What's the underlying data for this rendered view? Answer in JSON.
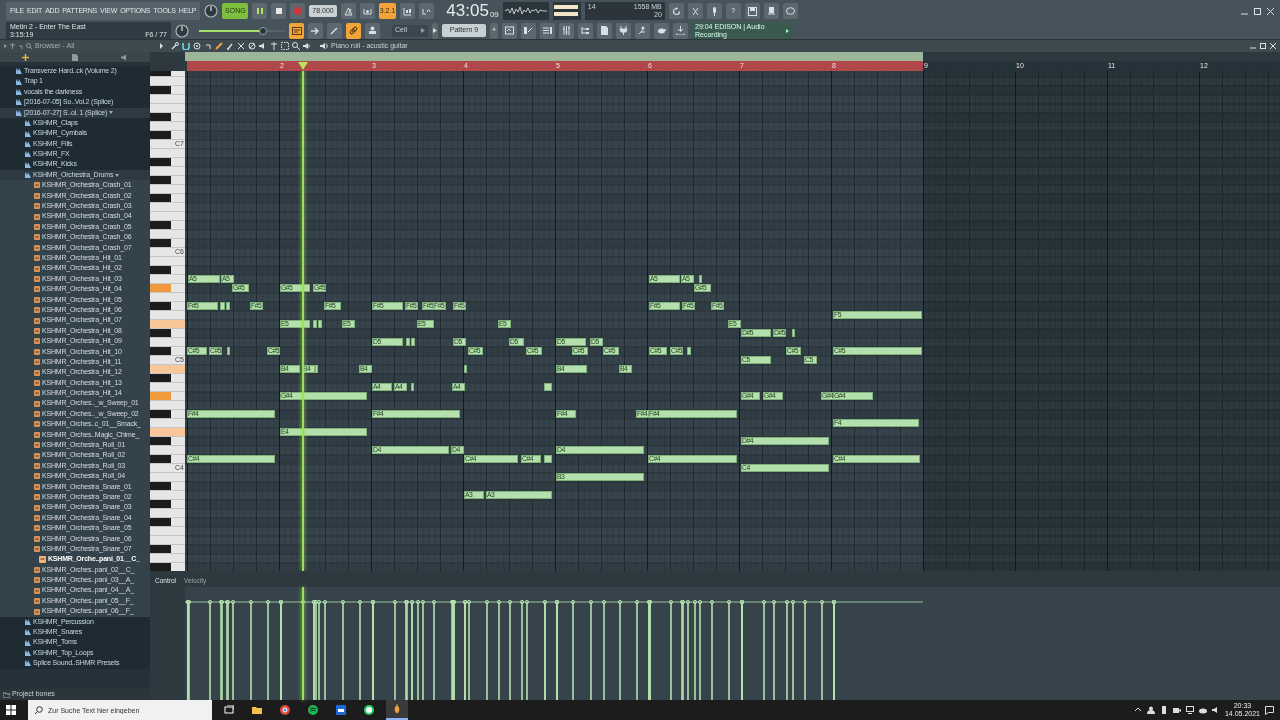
{
  "menu": [
    "FILE",
    "EDIT",
    "ADD",
    "PATTERNS",
    "VIEW",
    "OPTIONS",
    "TOOLS",
    "HELP"
  ],
  "transport": {
    "mode_label": "SONG",
    "song_mode": true,
    "playing": true,
    "recording": false,
    "tempo": "78.000"
  },
  "toggles": [
    {
      "on": false
    },
    {
      "on": false
    },
    {
      "label": "3.2.1",
      "on": true
    },
    {
      "on": false
    },
    {
      "on": false
    }
  ],
  "clock": {
    "main": "43:05",
    "sub": "09"
  },
  "monitor": {
    "cpu": "14",
    "memory": "1558 MB",
    "polyphony": "20"
  },
  "help_label": "?",
  "hint": {
    "title": "Metin 2 - Enter The East",
    "time": "3:15:19",
    "position": "F6 / 77"
  },
  "master_volume": {
    "level": 0.74
  },
  "tools": [
    {
      "on": true
    },
    {
      "on": false
    },
    {
      "on": false
    },
    {
      "on": true
    },
    {
      "on": false
    }
  ],
  "snap": "Cell",
  "pattern": {
    "name": "Pattern 9",
    "add": "+"
  },
  "news": {
    "time": "29:04",
    "title": "EDISON | Audio",
    "subtitle": "Recording"
  },
  "browser": {
    "title": "Browser - All",
    "items": [
      {
        "kind": "folder",
        "label": "Transverze Hard..ck (Volume 2)",
        "selected": false,
        "expanded": false
      },
      {
        "kind": "folder",
        "label": "Trap  1",
        "selected": false,
        "expanded": false
      },
      {
        "kind": "folder",
        "label": "vocals the darkness",
        "selected": false,
        "expanded": false
      },
      {
        "kind": "folder",
        "label": "[2016-07-05] So..Vol.2 (Splice)",
        "selected": false,
        "expanded": false
      },
      {
        "kind": "folder",
        "label": "[2016-07-27] S..ol. 1 (Splice)",
        "selected": false,
        "expanded": true,
        "children": [
          {
            "kind": "folder",
            "label": "KSHMR_Claps",
            "selected": false,
            "expanded": false
          },
          {
            "kind": "folder",
            "label": "KSHMR_Cymbals",
            "selected": false,
            "expanded": false
          },
          {
            "kind": "folder",
            "label": "KSHMR_Fills",
            "selected": false,
            "expanded": false
          },
          {
            "kind": "folder",
            "label": "KSHMR_FX",
            "selected": false,
            "expanded": false
          },
          {
            "kind": "folder",
            "label": "KSHMR_Kicks",
            "selected": false,
            "expanded": false
          },
          {
            "kind": "folder",
            "label": "KSHMR_Orchestra_Drums",
            "selected": false,
            "expanded": true,
            "children": [
              {
                "kind": "file",
                "label": "KSHMR_Orchestra_Crash_01",
                "selected": false
              },
              {
                "kind": "file",
                "label": "KSHMR_Orchestra_Crash_02",
                "selected": false
              },
              {
                "kind": "file",
                "label": "KSHMR_Orchestra_Crash_03",
                "selected": false
              },
              {
                "kind": "file",
                "label": "KSHMR_Orchestra_Crash_04",
                "selected": false
              },
              {
                "kind": "file",
                "label": "KSHMR_Orchestra_Crash_05",
                "selected": false
              },
              {
                "kind": "file",
                "label": "KSHMR_Orchestra_Crash_06",
                "selected": false
              },
              {
                "kind": "file",
                "label": "KSHMR_Orchestra_Crash_07",
                "selected": false
              },
              {
                "kind": "file",
                "label": "KSHMR_Orchestra_Hit_01",
                "selected": false
              },
              {
                "kind": "file",
                "label": "KSHMR_Orchestra_Hit_02",
                "selected": false
              },
              {
                "kind": "file",
                "label": "KSHMR_Orchestra_Hit_03",
                "selected": false
              },
              {
                "kind": "file",
                "label": "KSHMR_Orchestra_Hit_04",
                "selected": false
              },
              {
                "kind": "file",
                "label": "KSHMR_Orchestra_Hit_05",
                "selected": false
              },
              {
                "kind": "file",
                "label": "KSHMR_Orchestra_Hit_06",
                "selected": false
              },
              {
                "kind": "file",
                "label": "KSHMR_Orchestra_Hit_07",
                "selected": false
              },
              {
                "kind": "file",
                "label": "KSHMR_Orchestra_Hit_08",
                "selected": false
              },
              {
                "kind": "file",
                "label": "KSHMR_Orchestra_Hit_09",
                "selected": false
              },
              {
                "kind": "file",
                "label": "KSHMR_Orchestra_Hit_10",
                "selected": false
              },
              {
                "kind": "file",
                "label": "KSHMR_Orchestra_Hit_11",
                "selected": false
              },
              {
                "kind": "file",
                "label": "KSHMR_Orchestra_Hit_12",
                "selected": false
              },
              {
                "kind": "file",
                "label": "KSHMR_Orchestra_Hit_13",
                "selected": false
              },
              {
                "kind": "file",
                "label": "KSHMR_Orchestra_Hit_14",
                "selected": false
              },
              {
                "kind": "file",
                "label": "KSHMR_Orches.._w_Sweep_01",
                "selected": false
              },
              {
                "kind": "file",
                "label": "KSHMR_Orches.._w_Sweep_02",
                "selected": false
              },
              {
                "kind": "file",
                "label": "KSHMR_Orches..c_01__Smack_",
                "selected": false
              },
              {
                "kind": "file",
                "label": "KSHMR_Orches..Magic_Chime_",
                "selected": false
              },
              {
                "kind": "file",
                "label": "KSHMR_Orchestra_Roll_01",
                "selected": false
              },
              {
                "kind": "file",
                "label": "KSHMR_Orchestra_Roll_02",
                "selected": false
              },
              {
                "kind": "file",
                "label": "KSHMR_Orchestra_Roll_03",
                "selected": false
              },
              {
                "kind": "file",
                "label": "KSHMR_Orchestra_Roll_04",
                "selected": false
              },
              {
                "kind": "file",
                "label": "KSHMR_Orchestra_Snare_01",
                "selected": false
              },
              {
                "kind": "file",
                "label": "KSHMR_Orchestra_Snare_02",
                "selected": false
              },
              {
                "kind": "file",
                "label": "KSHMR_Orchestra_Snare_03",
                "selected": false
              },
              {
                "kind": "file",
                "label": "KSHMR_Orchestra_Snare_04",
                "selected": false
              },
              {
                "kind": "file",
                "label": "KSHMR_Orchestra_Snare_05",
                "selected": false
              },
              {
                "kind": "file",
                "label": "KSHMR_Orchestra_Snare_06",
                "selected": false
              },
              {
                "kind": "file",
                "label": "KSHMR_Orchestra_Snare_07",
                "selected": false
              },
              {
                "kind": "file",
                "label": "KSHMR_Orche..pani_01__C_",
                "selected": true
              },
              {
                "kind": "file",
                "label": "KSHMR_Orches..pani_02__C_",
                "selected": false
              },
              {
                "kind": "file",
                "label": "KSHMR_Orches..pani_03__A_",
                "selected": false
              },
              {
                "kind": "file",
                "label": "KSHMR_Orches..pani_04__A_",
                "selected": false
              },
              {
                "kind": "file",
                "label": "KSHMR_Orches..pani_05__F_",
                "selected": false
              },
              {
                "kind": "file",
                "label": "KSHMR_Orches..pani_06__F_",
                "selected": false
              }
            ]
          },
          {
            "kind": "folder",
            "label": "KSHMR_Percussion",
            "selected": false,
            "expanded": false
          },
          {
            "kind": "folder",
            "label": "KSHMR_Snares",
            "selected": false,
            "expanded": false
          },
          {
            "kind": "folder",
            "label": "KSHMR_Toms",
            "selected": false,
            "expanded": false
          },
          {
            "kind": "folder",
            "label": "KSHMR_Top_Loops",
            "selected": false,
            "expanded": false
          },
          {
            "kind": "folder",
            "label": "Splice Sound..SHMR Presets",
            "selected": false,
            "expanded": false
          }
        ]
      }
    ],
    "footer": "Project bones"
  },
  "piano_roll": {
    "title": "Piano roll - acustic guitar",
    "ruler": [
      "2",
      "3",
      "4",
      "5",
      "6",
      "7",
      "8",
      "9",
      "10",
      "11",
      "12"
    ],
    "octaves": [
      "C7",
      "C6",
      "C5",
      "C4"
    ],
    "notes": [
      {
        "label": "A5",
        "selected": false
      },
      {
        "label": "A5",
        "selected": false
      },
      {
        "label": "A5",
        "selected": false
      },
      {
        "label": "A5",
        "selected": false
      },
      {
        "selected": false
      },
      {
        "label": "G#5",
        "selected": false
      },
      {
        "label": "G#5",
        "selected": false
      },
      {
        "label": "G#5",
        "selected": false
      },
      {
        "label": "G#5",
        "selected": false
      },
      {
        "label": "F#5",
        "selected": false
      },
      {
        "selected": false
      },
      {
        "selected": false
      },
      {
        "label": "F#5",
        "selected": false
      },
      {
        "label": "F#5",
        "selected": false
      },
      {
        "label": "F#5",
        "selected": false
      },
      {
        "label": "F#5",
        "selected": false
      },
      {
        "label": "F#5",
        "selected": false
      },
      {
        "label": "F#5",
        "selected": false
      },
      {
        "label": "F#5",
        "selected": false
      },
      {
        "label": "F#5",
        "selected": false
      },
      {
        "label": "F#5",
        "selected": false
      },
      {
        "label": "F#5",
        "selected": false
      },
      {
        "label": "F5",
        "selected": false
      },
      {
        "label": "E5",
        "selected": false
      },
      {
        "selected": false
      },
      {
        "selected": false
      },
      {
        "label": "E5",
        "selected": false
      },
      {
        "label": "E5",
        "selected": false
      },
      {
        "label": "E5",
        "selected": false
      },
      {
        "label": "E5",
        "selected": false
      },
      {
        "label": "D#5",
        "selected": false
      },
      {
        "label": "D#5",
        "selected": false
      },
      {
        "selected": false
      },
      {
        "label": "D5",
        "selected": false
      },
      {
        "selected": false
      },
      {
        "selected": false
      },
      {
        "label": "D5",
        "selected": false
      },
      {
        "label": "D5",
        "selected": false
      },
      {
        "label": "D5",
        "selected": false
      },
      {
        "label": "D5",
        "selected": false
      },
      {
        "label": "C#5",
        "selected": false
      },
      {
        "label": "C#5",
        "selected": false
      },
      {
        "selected": false
      },
      {
        "label": "C#5",
        "selected": false
      },
      {
        "label": "C#5",
        "selected": false
      },
      {
        "label": "C#5",
        "selected": false
      },
      {
        "label": "C#5",
        "selected": false
      },
      {
        "label": "C#5",
        "selected": false
      },
      {
        "label": "C#5",
        "selected": false
      },
      {
        "label": "C#5",
        "selected": false
      },
      {
        "selected": false
      },
      {
        "label": "C#5",
        "selected": false
      },
      {
        "label": "C#5",
        "selected": false
      },
      {
        "label": "C5",
        "selected": false
      },
      {
        "label": "C5",
        "selected": false
      },
      {
        "label": "B4",
        "selected": false
      },
      {
        "label": "B4",
        "selected": false
      },
      {
        "selected": false
      },
      {
        "label": "B4",
        "selected": false
      },
      {
        "selected": false
      },
      {
        "label": "B4",
        "selected": false
      },
      {
        "label": "B4",
        "selected": false
      },
      {
        "label": "A4",
        "selected": false
      },
      {
        "label": "A4",
        "selected": false
      },
      {
        "selected": false
      },
      {
        "label": "A4",
        "selected": false
      },
      {
        "selected": false
      },
      {
        "label": "G#4",
        "selected": false
      },
      {
        "label": "G#4",
        "selected": false
      },
      {
        "label": "G#4",
        "selected": false
      },
      {
        "label": "G#4",
        "selected": false
      },
      {
        "label": "G#4",
        "selected": false
      },
      {
        "label": "F#4",
        "selected": false
      },
      {
        "label": "F#4",
        "selected": false
      },
      {
        "label": "F#4",
        "selected": false
      },
      {
        "label": "F#4",
        "selected": false
      },
      {
        "label": "F#4",
        "selected": false
      },
      {
        "label": "F4",
        "selected": false
      },
      {
        "label": "E4",
        "selected": false
      },
      {
        "label": "D#4",
        "selected": false
      },
      {
        "label": "D4",
        "selected": false
      },
      {
        "label": "D4",
        "selected": false
      },
      {
        "label": "D4",
        "selected": false
      },
      {
        "label": "C#4",
        "selected": false
      },
      {
        "label": "C#4",
        "selected": false
      },
      {
        "label": "C#4",
        "selected": false
      },
      {
        "selected": false
      },
      {
        "label": "C#4",
        "selected": false
      },
      {
        "label": "C#4",
        "selected": false
      },
      {
        "label": "C4",
        "selected": false
      },
      {
        "label": "B3",
        "selected": false
      },
      {
        "label": "A3",
        "selected": false
      },
      {
        "label": "A3",
        "selected": false
      }
    ],
    "control": {
      "title": "Control",
      "lane": "Velocity"
    }
  },
  "taskbar": {
    "search_placeholder": "Zur Suche Text hier eingeben",
    "time": "20:33",
    "date": "14.05.2021"
  }
}
